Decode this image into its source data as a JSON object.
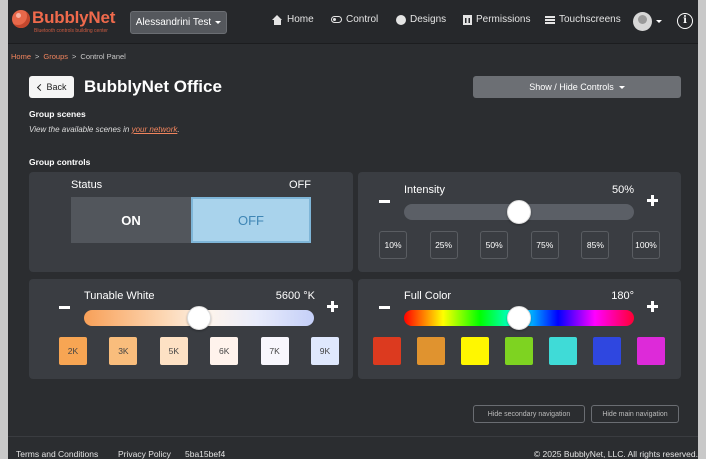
{
  "colors": {
    "brand": "#ef6a4c",
    "background": "#2b2d30",
    "panel": "#3a3d42",
    "off_active": "#a9d3ec",
    "link": "#f0845d"
  },
  "navbar": {
    "brand_name": "BubblyNet",
    "brand_tagline": "Bluetooth controls building center",
    "account": "Alessandrini Test",
    "items": [
      {
        "label": "Home",
        "icon": "home-icon"
      },
      {
        "label": "Control",
        "icon": "toggle-icon"
      },
      {
        "label": "Designs",
        "icon": "palette-icon"
      },
      {
        "label": "Permissions",
        "icon": "bank-icon"
      },
      {
        "label": "Touchscreens",
        "icon": "lines-icon"
      }
    ],
    "info_glyph": "i"
  },
  "breadcrumb": {
    "home": "Home",
    "sep1": ">",
    "groups": "Groups",
    "sep2": ">",
    "current": "Control Panel"
  },
  "header": {
    "back_label": "Back",
    "title": "BubblyNet Office",
    "show_hide_label": "Show / Hide Controls"
  },
  "scenes": {
    "heading": "Group scenes",
    "text_prefix": "View the available scenes in ",
    "link_text": "your network",
    "text_suffix": "."
  },
  "controls": {
    "heading": "Group controls",
    "status": {
      "label": "Status",
      "value": "OFF",
      "on_label": "ON",
      "off_label": "OFF"
    },
    "intensity": {
      "label": "Intensity",
      "value": "50%",
      "level": 0.5,
      "presets": [
        "10%",
        "25%",
        "50%",
        "75%",
        "85%",
        "100%"
      ]
    },
    "tunable_white": {
      "label": "Tunable White",
      "value": "5600 °K",
      "level": 0.5,
      "presets": [
        "2K",
        "3K",
        "5K",
        "6K",
        "7K",
        "9K"
      ],
      "preset_colors": [
        "#f7a553",
        "#f9bd7c",
        "#fde1c4",
        "#fff3ec",
        "#f8f7fd",
        "#dfe8fd"
      ]
    },
    "full_color": {
      "label": "Full Color",
      "value": "180°",
      "level": 0.5,
      "swatches": [
        "#dc3a1f",
        "#e0932f",
        "#fff700",
        "#7ed321",
        "#3fdbd7",
        "#2f47e0",
        "#dd2ad9"
      ]
    }
  },
  "bottom_nav": {
    "hide_secondary": "Hide secondary navigation",
    "hide_main": "Hide main navigation"
  },
  "footer": {
    "terms": "Terms and Conditions",
    "privacy": "Privacy Policy",
    "build": "5ba15bef4",
    "copyright": "© 2025 BubblyNet, LLC. All rights reserved."
  }
}
